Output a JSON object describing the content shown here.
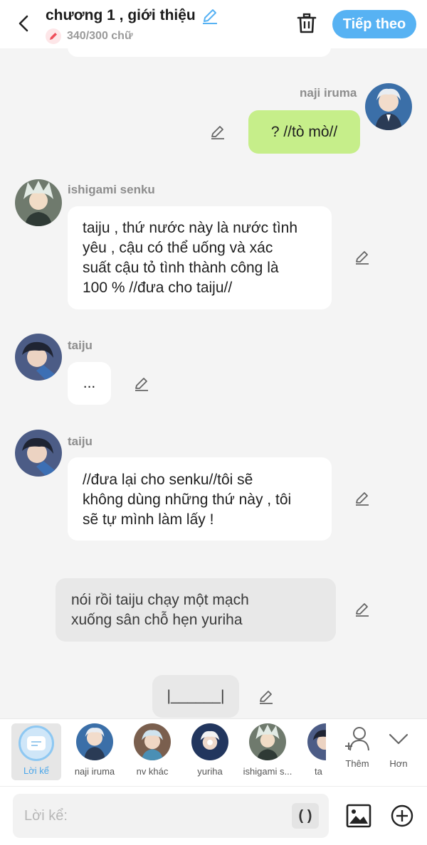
{
  "header": {
    "title": "chương 1 , giới thiệu",
    "word_count": "340/300 chữ",
    "next_label": "Tiếp theo"
  },
  "messages": [
    {
      "speaker": "naji iruma",
      "text": "? //tò mò//",
      "side": "right"
    },
    {
      "speaker": "ishigami senku",
      "lines": [
        "taiju , thứ nước này là nước tình",
        "yêu , cậu có thể uống và xác",
        "suất cậu tỏ tình thành công là",
        "100 % //đưa cho taiju//"
      ]
    },
    {
      "speaker": "taiju",
      "text": "..."
    },
    {
      "speaker": "taiju",
      "lines": [
        "//đưa lại cho senku//tôi sẽ",
        "không dùng những thứ này , tôi",
        "sẽ tự mình làm lấy !"
      ]
    },
    {
      "narration_lines": [
        "nói rồi taiju chạy một mạch",
        "xuống sân chỗ hẹn yuriha"
      ]
    },
    {
      "narration_text": "|______|"
    }
  ],
  "characters": [
    {
      "label": "Lời kể"
    },
    {
      "label": "naji iruma"
    },
    {
      "label": "nv khác"
    },
    {
      "label": "yuriha"
    },
    {
      "label": "ishigami s..."
    },
    {
      "label": "ta"
    }
  ],
  "more": {
    "add_label": "Thêm",
    "more_label": "Hơn"
  },
  "input": {
    "placeholder": "Lời kể:",
    "paren_label": "( )"
  },
  "colors": {
    "accent": "#57b2f3",
    "right_bubble": "#c6ee8a",
    "narration_bubble": "#e8e8e8"
  }
}
